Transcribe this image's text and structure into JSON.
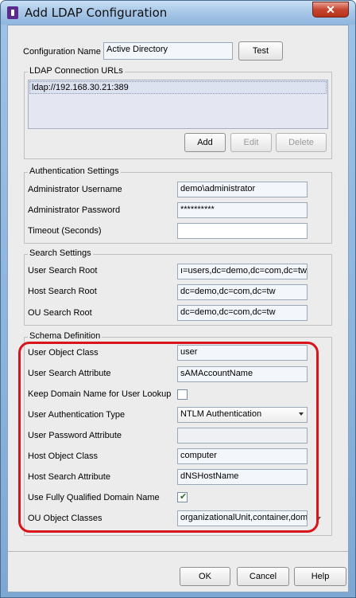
{
  "window": {
    "title": "Add LDAP Configuration",
    "close_glyph": "✕"
  },
  "config": {
    "name_label": "Configuration Name",
    "name_value": "Active Directory",
    "test_button": "Test"
  },
  "ldap": {
    "group_title": "LDAP Connection URLs",
    "urls": [
      "ldap://192.168.30.21:389"
    ],
    "add_button": "Add",
    "edit_button": "Edit",
    "delete_button": "Delete"
  },
  "auth": {
    "group_title": "Authentication Settings",
    "username_label": "Administrator Username",
    "username_value": "demo\\administrator",
    "password_label": "Administrator Password",
    "password_value": "**********",
    "timeout_label": "Timeout (Seconds)",
    "timeout_value": ""
  },
  "search": {
    "group_title": "Search Settings",
    "user_root_label": "User Search Root",
    "user_root_value": "ı=users,dc=demo,dc=com,dc=tw",
    "host_root_label": "Host Search Root",
    "host_root_value": "dc=demo,dc=com,dc=tw",
    "ou_root_label": "OU Search Root",
    "ou_root_value": "dc=demo,dc=com,dc=tw"
  },
  "schema": {
    "group_title": "Schema Definition",
    "user_object_class_label": "User Object Class",
    "user_object_class_value": "user",
    "user_search_attr_label": "User Search Attribute",
    "user_search_attr_value": "sAMAccountName",
    "keep_domain_label": "Keep Domain Name for User Lookup",
    "keep_domain_checked": false,
    "auth_type_label": "User Authentication Type",
    "auth_type_value": "NTLM Authentication",
    "pwd_attr_label": "User Password Attribute",
    "pwd_attr_value": "",
    "host_object_class_label": "Host Object Class",
    "host_object_class_value": "computer",
    "host_search_attr_label": "Host Search Attribute",
    "host_search_attr_value": "dNSHostName",
    "fqdn_label": "Use Fully Qualified Domain Name",
    "fqdn_checked": true,
    "ou_classes_label": "OU Object Classes",
    "ou_classes_value": "organizationalUnit,container,doma"
  },
  "footer": {
    "ok_button": "OK",
    "cancel_button": "Cancel",
    "help_button": "Help"
  },
  "colors": {
    "highlight": "#d8141c",
    "checkmark": "#2a6e2a"
  }
}
